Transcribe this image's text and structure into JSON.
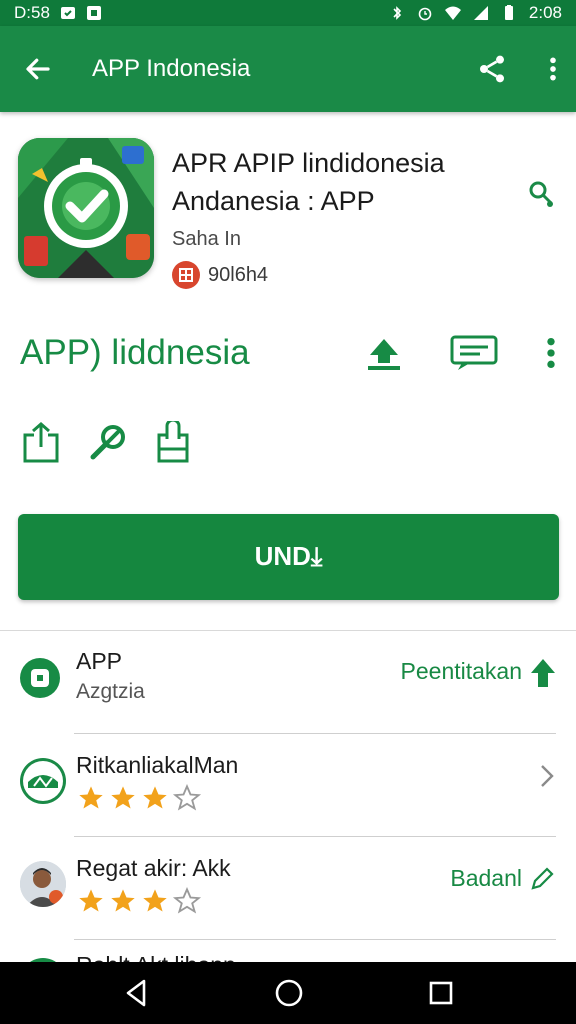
{
  "status_bar": {
    "time_left": "D:58",
    "time_right": "2:08"
  },
  "app_bar": {
    "title": "APP Indonesia",
    "back_icon": "arrow-left-icon",
    "share_icon": "share-icon",
    "menu_icon": "more-vert-icon"
  },
  "app": {
    "name_line1": "APR APIP lindidonesia",
    "name_line2": "Andanesia : APP",
    "developer": "Saha In",
    "meta_text": "90l6h4"
  },
  "section": {
    "title": "APP) liddnesia"
  },
  "install": {
    "label": "UND⤓"
  },
  "list": [
    {
      "title": "APP",
      "subtitle": "Azgtzia",
      "trail_label": "Peentitakan",
      "trail_icon": "up-arrow-icon"
    },
    {
      "title": "RitkanliakalMan",
      "rating": 3,
      "trail_icon": "chevron-right-icon"
    },
    {
      "title": "Regat akir: Akk",
      "rating": 3,
      "trail_label": "Badanl",
      "trail_icon": "edit-icon"
    },
    {
      "title": "Rahlt Akt lihann"
    }
  ],
  "colors": {
    "primary": "#1a8a47",
    "status": "#0f7a3a",
    "accent_text": "#178b45",
    "star": "#f2a21b"
  }
}
